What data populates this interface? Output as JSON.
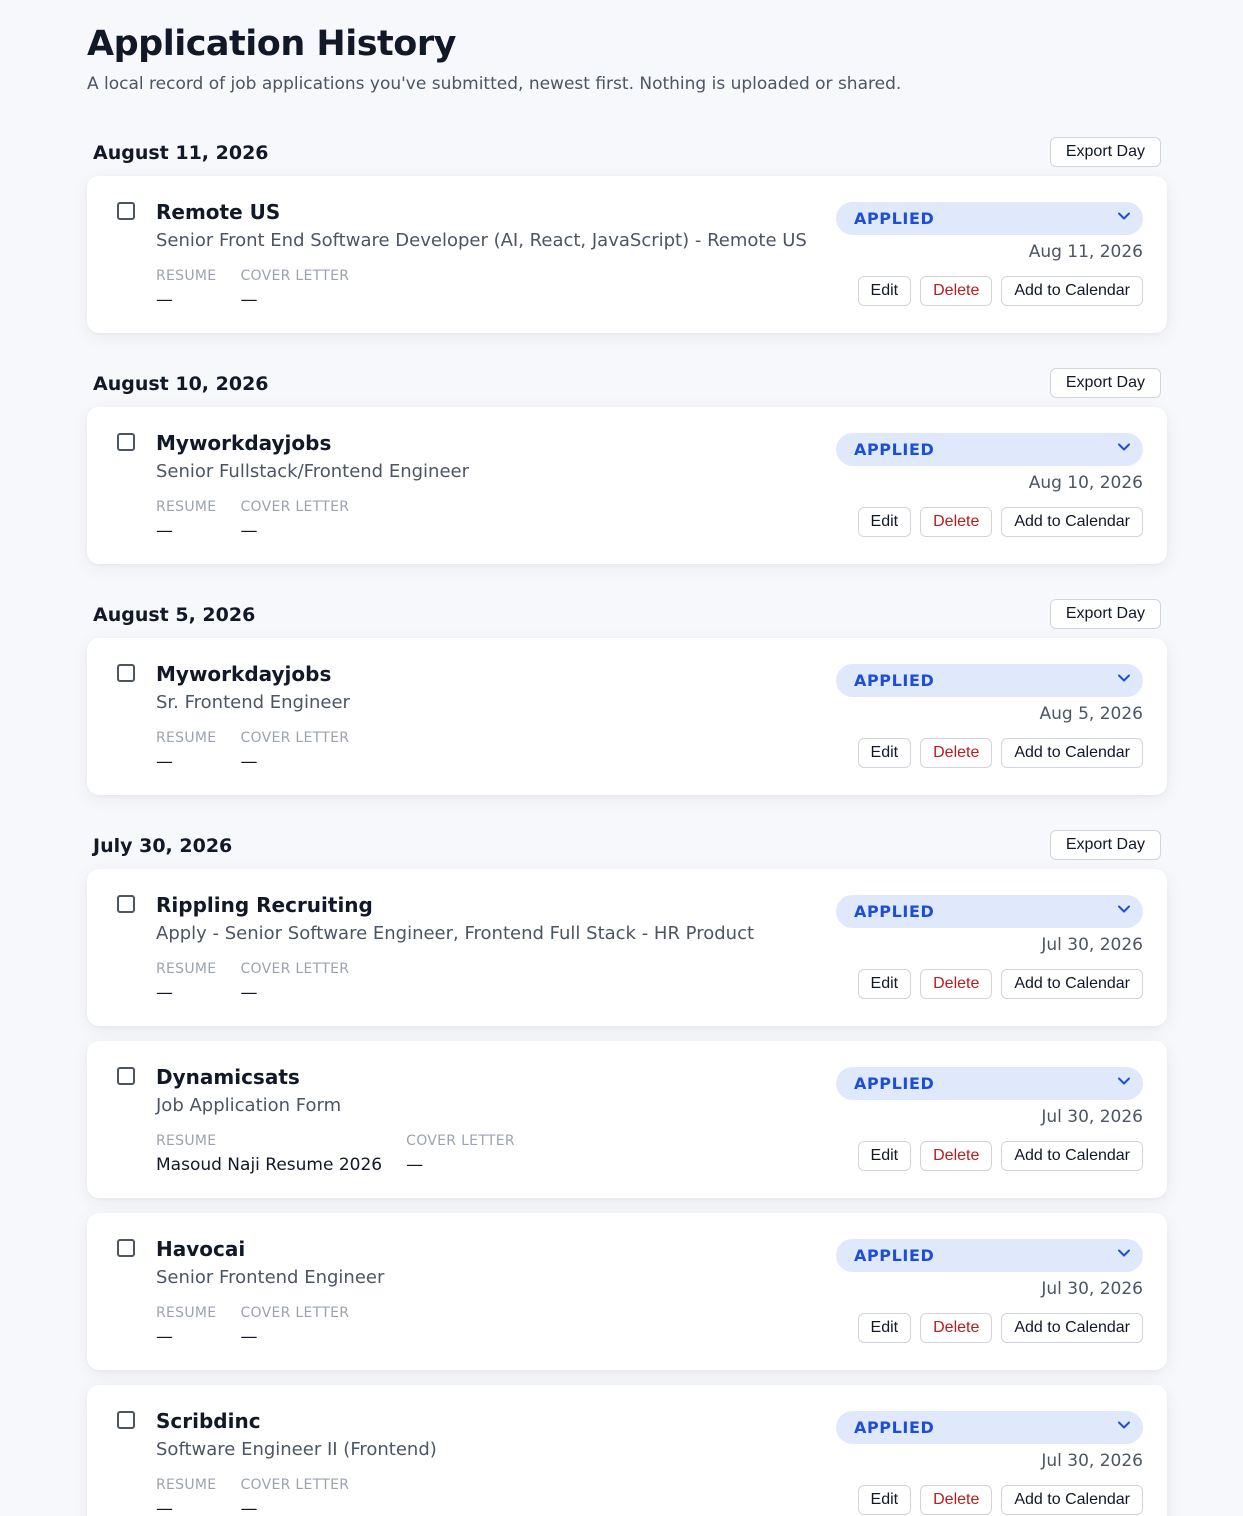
{
  "header": {
    "title": "Application History",
    "subtitle": "A local record of job applications you've submitted, newest first. Nothing is uploaded or shared."
  },
  "labels": {
    "export_day": "Export Day",
    "resume": "RESUME",
    "cover_letter": "COVER LETTER",
    "edit": "Edit",
    "delete": "Delete",
    "add_to_calendar": "Add to Calendar",
    "status_applied": "APPLIED"
  },
  "colors": {
    "background": "#f7f8fb",
    "status_bg": "#e0e9fb",
    "status_text": "#1d4ed8",
    "delete_text": "#b91c1c"
  },
  "groups": [
    {
      "date": "August 11, 2026",
      "applications": [
        {
          "company": "Remote US",
          "role": "Senior Front End Software Developer (AI, React, JavaScript) - Remote US",
          "status": "APPLIED",
          "date": "Aug 11, 2026",
          "resume": "—",
          "cover_letter": "—"
        }
      ]
    },
    {
      "date": "August 10, 2026",
      "applications": [
        {
          "company": "Myworkdayjobs",
          "role": "Senior Fullstack/Frontend Engineer",
          "status": "APPLIED",
          "date": "Aug 10, 2026",
          "resume": "—",
          "cover_letter": "—"
        }
      ]
    },
    {
      "date": "August 5, 2026",
      "applications": [
        {
          "company": "Myworkdayjobs",
          "role": "Sr. Frontend Engineer",
          "status": "APPLIED",
          "date": "Aug 5, 2026",
          "resume": "—",
          "cover_letter": "—"
        }
      ]
    },
    {
      "date": "July 30, 2026",
      "applications": [
        {
          "company": "Rippling Recruiting",
          "role": "Apply - Senior Software Engineer, Frontend Full Stack - HR Product",
          "status": "APPLIED",
          "date": "Jul 30, 2026",
          "resume": "—",
          "cover_letter": "—"
        },
        {
          "company": "Dynamicsats",
          "role": "Job Application Form",
          "status": "APPLIED",
          "date": "Jul 30, 2026",
          "resume": "Masoud Naji Resume 2026",
          "cover_letter": "—"
        },
        {
          "company": "Havocai",
          "role": "Senior Frontend Engineer",
          "status": "APPLIED",
          "date": "Jul 30, 2026",
          "resume": "—",
          "cover_letter": "—"
        },
        {
          "company": "Scribdinc",
          "role": "Software Engineer II (Frontend)",
          "status": "APPLIED",
          "date": "Jul 30, 2026",
          "resume": "—",
          "cover_letter": "—"
        }
      ]
    }
  ]
}
